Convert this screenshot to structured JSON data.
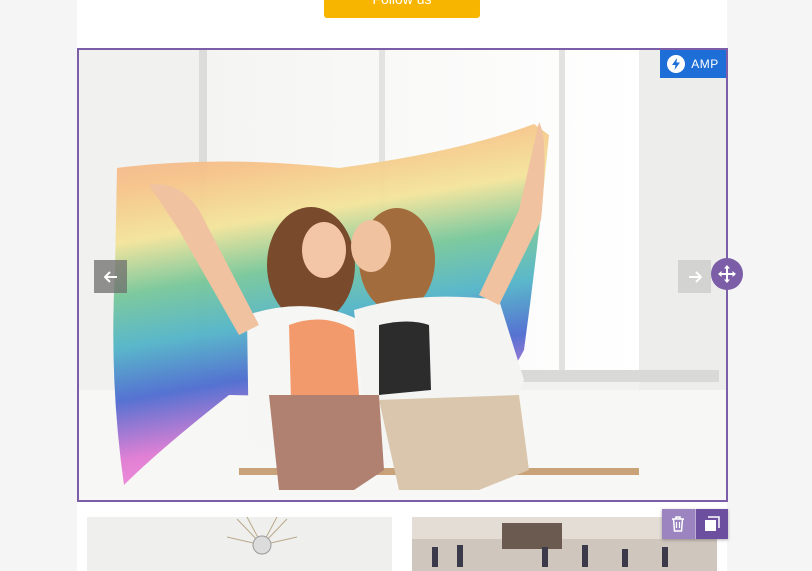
{
  "header": {
    "follow_label": "Follow us"
  },
  "carousel": {
    "badge_label": "AMP",
    "accent_color": "#7b5ea7",
    "badge_color": "#1e6ed8",
    "icons": {
      "badge": "lightning-bolt-icon",
      "prev": "arrow-left-icon",
      "next": "arrow-right-icon",
      "move": "move-arrows-icon"
    }
  },
  "toolbar": {
    "icons": {
      "delete": "trash-icon",
      "duplicate": "copy-icon"
    }
  },
  "colors": {
    "follow_button": "#f7b500"
  }
}
